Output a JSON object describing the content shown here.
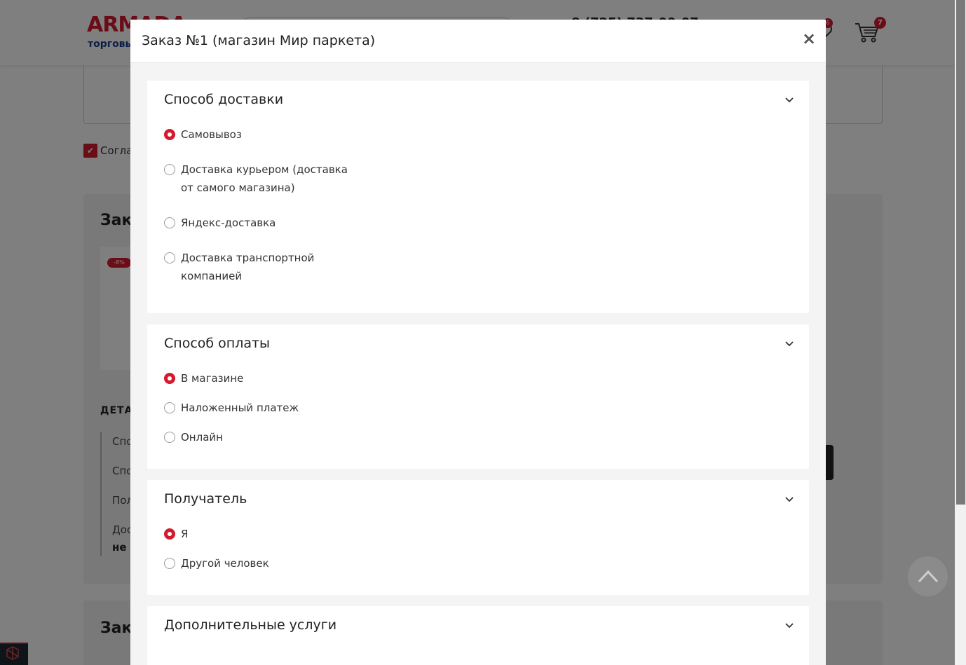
{
  "background": {
    "logo": "ARMADA",
    "logo_sub": "торговы",
    "phone": "8 (725) 737-00-07",
    "favorites_count": "6",
    "cart_count": "7",
    "agree_label": "Согла",
    "order_title": "Зак",
    "sale_badge": "-8%",
    "details_heading": "ДЕТА",
    "detail_rows": [
      "Спо",
      "Спо",
      "Пол",
      "Дос"
    ],
    "detail_bold": "не",
    "order2_title": "Зак"
  },
  "modal": {
    "title": "Заказ №1 (магазин Мир паркета)",
    "close_label": "×",
    "sections": {
      "delivery": {
        "title": "Способ доставки",
        "options": [
          {
            "label": "Самовывоз",
            "checked": true
          },
          {
            "label": "Доставка курьером (доставка от самого магазина)",
            "checked": false
          },
          {
            "label": "Яндекс-доставка",
            "checked": false
          },
          {
            "label": "Доставка транспортной компанией",
            "checked": false
          }
        ]
      },
      "payment": {
        "title": "Способ оплаты",
        "options": [
          {
            "label": "В магазине",
            "checked": true
          },
          {
            "label": "Наложенный платеж",
            "checked": false
          },
          {
            "label": "Онлайн",
            "checked": false
          }
        ]
      },
      "recipient": {
        "title": "Получатель",
        "options": [
          {
            "label": "Я",
            "checked": true
          },
          {
            "label": "Другой человек",
            "checked": false
          }
        ]
      },
      "extra": {
        "title": "Дополнительные услуги"
      }
    }
  },
  "colors": {
    "accent": "#d41a2e",
    "overlay": "rgba(0,0,0,0.5)",
    "modal_bg": "#f4f4f4"
  },
  "icons": {
    "close": "close-icon",
    "chevron": "chevron-down-icon",
    "cart": "cart-icon",
    "favorites": "heart-icon",
    "scroll_top": "chevron-up-icon"
  }
}
